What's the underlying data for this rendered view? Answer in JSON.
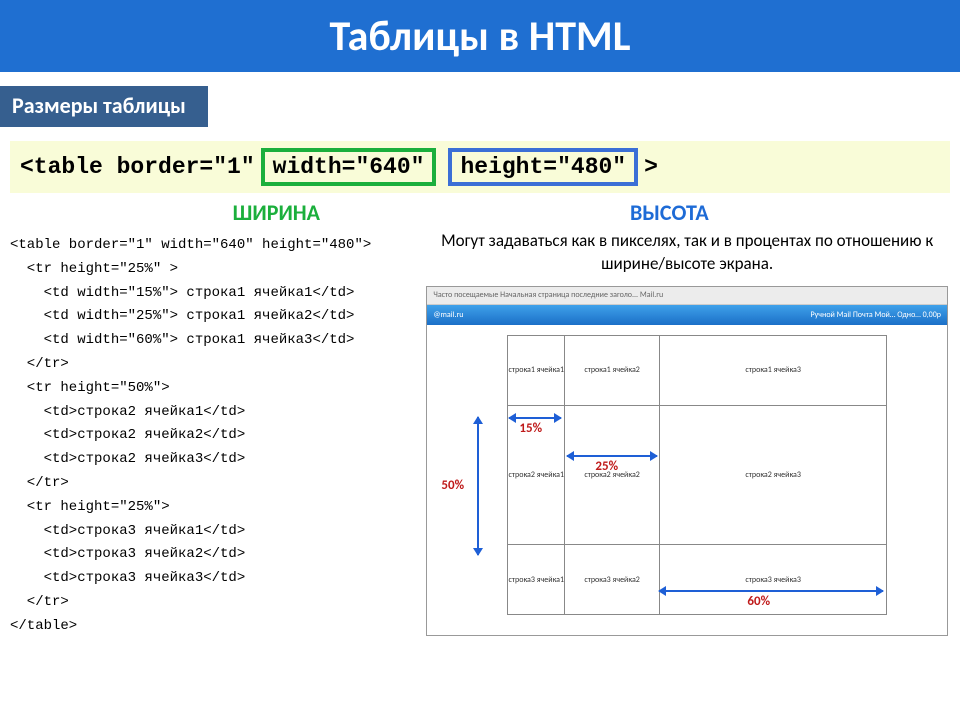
{
  "title": "Таблицы в HTML",
  "subtitle": "Размеры таблицы",
  "tag": {
    "prefix": "<table border=\"1\"",
    "width_attr": "width=\"640\"",
    "height_attr": "height=\"480\"",
    "suffix": ">"
  },
  "labels": {
    "width": "ШИРИНА",
    "height": "ВЫСОТА"
  },
  "caption": "Могут задаваться как в пикселях,\nтак и в процентах по отношению к\nширине/высоте экрана.",
  "code": "<table border=\"1\" width=\"640\" height=\"480\">\n  <tr height=\"25%\" >\n    <td width=\"15%\"> строка1 ячейка1</td>\n    <td width=\"25%\"> строка1 ячейка2</td>\n    <td width=\"60%\"> строка1 ячейка3</td>\n  </tr>\n  <tr height=\"50%\">\n    <td>строка2 ячейка1</td>\n    <td>строка2 ячейка2</td>\n    <td>строка2 ячейка3</td>\n  </tr>\n  <tr height=\"25%\">\n    <td>строка3 ячейка1</td>\n    <td>строка3 ячейка2</td>\n    <td>строка3 ячейка3</td>\n  </tr>\n</table>",
  "browser": {
    "bar1": "Часто посещаемые   Начальная страница   последние заголо...   Mail.ru",
    "bar2_left": "@mail.ru",
    "bar2_right": "Ручной   Mail   Почта   Мой…   Одно…   0,00р"
  },
  "cells": {
    "r1c1": "строка1\nячейка1",
    "r1c2": "строка1 ячейка2",
    "r1c3": "строка1 ячейка3",
    "r2c1": "строка2\nячейка1",
    "r2c2": "строка2 ячейка2",
    "r2c3": "строка2 ячейка3",
    "r3c1": "строка3\nячейка1",
    "r3c2": "строка3 ячейка2",
    "r3c3": "строка3 ячейка3"
  },
  "dims": {
    "w15": "15%",
    "w25": "25%",
    "w60": "60%",
    "h50": "50%"
  }
}
